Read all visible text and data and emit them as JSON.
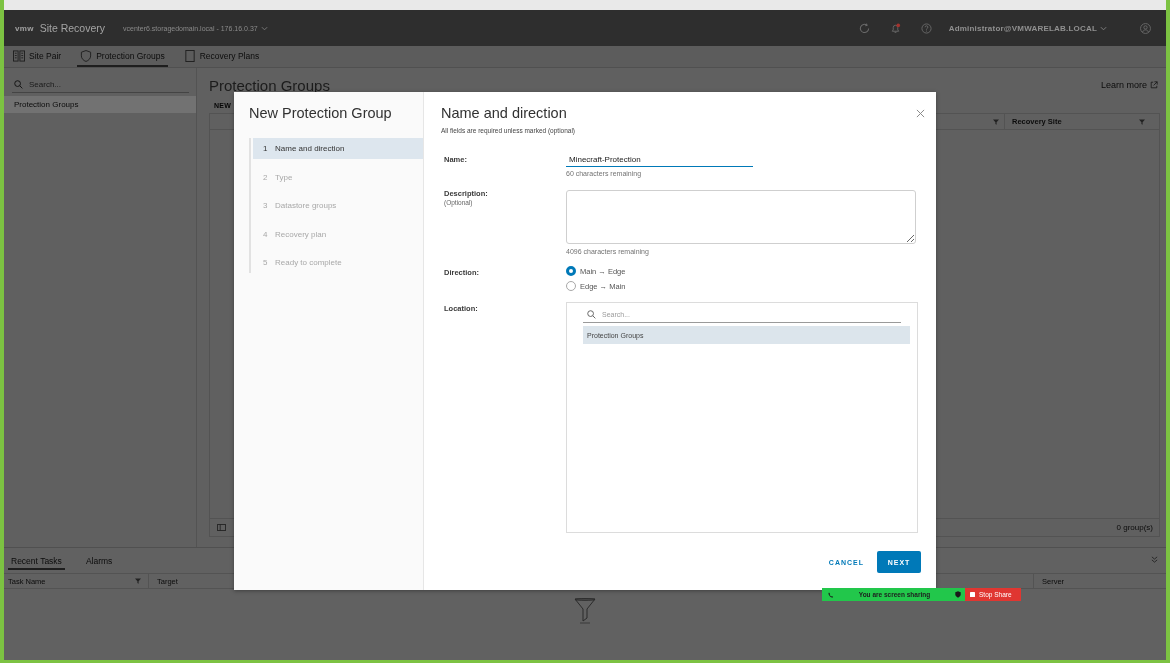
{
  "header": {
    "logo": "vmw",
    "app_title": "Site Recovery",
    "server": "vcenter6.storagedomain.local - 176.16.0.37",
    "has_alert": true,
    "user": "Administrator@VMWARELAB.LOCAL"
  },
  "tabs": [
    {
      "label": "Site Pair",
      "selected": false
    },
    {
      "label": "Protection Groups",
      "selected": true
    },
    {
      "label": "Recovery Plans",
      "selected": false
    }
  ],
  "sidebar": {
    "search_placeholder": "Search...",
    "items": [
      {
        "label": "Protection Groups",
        "selected": true
      }
    ]
  },
  "main": {
    "title": "Protection Groups",
    "learn_more": "Learn more",
    "new_button": "NEW",
    "table": {
      "columns": [
        "Recovery Site"
      ],
      "footer": "0 group(s)"
    }
  },
  "bottom_panel": {
    "tabs": [
      {
        "label": "Recent Tasks",
        "selected": true
      },
      {
        "label": "Alarms",
        "selected": false
      }
    ],
    "columns": [
      "Task Name",
      "Target",
      "Server"
    ]
  },
  "dialog": {
    "title": "New Protection Group",
    "steps": [
      {
        "number": "1",
        "label": "Name and direction",
        "selected": true,
        "disabled": false
      },
      {
        "number": "2",
        "label": "Type",
        "selected": false,
        "disabled": true
      },
      {
        "number": "3",
        "label": "Datastore groups",
        "selected": false,
        "disabled": true
      },
      {
        "number": "4",
        "label": "Recovery plan",
        "selected": false,
        "disabled": true
      },
      {
        "number": "5",
        "label": "Ready to complete",
        "selected": false,
        "disabled": true
      }
    ],
    "page_title": "Name and direction",
    "note": "All fields are required unless marked (optional)",
    "name": {
      "label": "Name:",
      "value": "Minecraft-Protection",
      "hint": "60 characters remaining"
    },
    "description": {
      "label": "Description:",
      "optional": "(Optional)",
      "hint": "4096 characters remaining"
    },
    "direction": {
      "label": "Direction:",
      "options": [
        {
          "label": "Main → Edge",
          "selected": true
        },
        {
          "label": "Edge → Main",
          "selected": false
        }
      ]
    },
    "location": {
      "label": "Location:",
      "search_placeholder": "Search...",
      "items": [
        {
          "label": "Protection Groups",
          "selected": true
        }
      ]
    },
    "buttons": [
      {
        "label": "CANCEL",
        "kind": "secondary"
      },
      {
        "label": "NEXT",
        "kind": "primary"
      }
    ]
  },
  "screen_share": {
    "status": "You are screen sharing",
    "stop_button": "Stop Share"
  }
}
